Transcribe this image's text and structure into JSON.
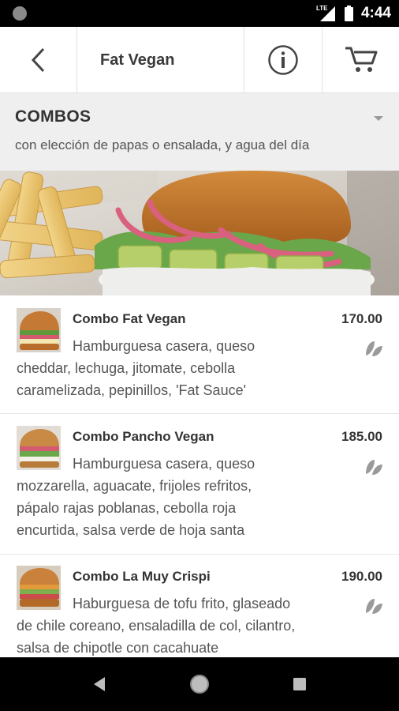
{
  "status": {
    "network": "LTE",
    "time": "4:44"
  },
  "header": {
    "title": "Fat Vegan",
    "icons": [
      "back-arrow-icon",
      "info-icon",
      "cart-icon"
    ]
  },
  "section": {
    "title": "COMBOS",
    "subtitle": "con elección de papas o ensalada, y agua del día"
  },
  "items": [
    {
      "name": "Combo Fat Vegan",
      "price": "170.00",
      "desc_first": "Hamburguesa casera, queso",
      "desc_rest": [
        "cheddar, lechuga, jitomate, cebolla",
        "caramelizada, pepinillos, 'Fat Sauce'"
      ]
    },
    {
      "name": "Combo Pancho Vegan",
      "price": "185.00",
      "desc_first": "Hamburguesa casera, queso",
      "desc_rest": [
        "mozzarella, aguacate, frijoles refritos,",
        "pápalo rajas poblanas, cebolla roja",
        "encurtida, salsa verde de hoja santa"
      ]
    },
    {
      "name": "Combo La Muy Crispi",
      "price": "190.00",
      "desc_first": "Haburguesa de tofu frito, glaseado",
      "desc_rest": [
        "de chile coreano, ensaladilla de col, cilantro,",
        "salsa de chipotle con cacahuate"
      ]
    }
  ],
  "nav": {
    "icons": [
      "back-triangle-icon",
      "home-circle-icon",
      "recents-square-icon"
    ]
  }
}
